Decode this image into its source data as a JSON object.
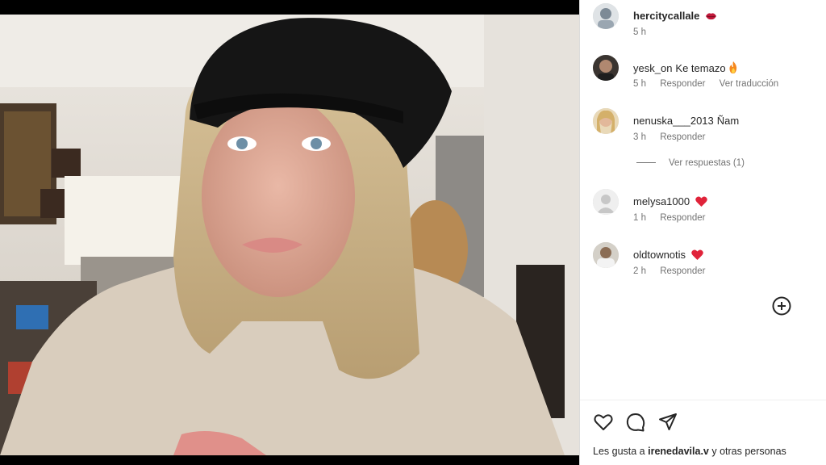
{
  "post": {
    "photo_alt": "selfie photo"
  },
  "comments": [
    {
      "user": "hercitycallale",
      "text": "",
      "emoji": "lips",
      "time": "5 h",
      "reply_label": "",
      "translate_label": ""
    },
    {
      "user": "yesk_on",
      "text": "Ke temazo",
      "emoji": "fire",
      "time": "5 h",
      "reply_label": "Responder",
      "translate_label": "Ver traducción"
    },
    {
      "user": "nenuska___2013",
      "text": "Ñam",
      "emoji": "",
      "time": "3 h",
      "reply_label": "Responder",
      "translate_label": ""
    },
    {
      "user": "melysa1000",
      "text": "",
      "emoji": "heart",
      "time": "1 h",
      "reply_label": "Responder",
      "translate_label": ""
    },
    {
      "user": "oldtownotis",
      "text": "",
      "emoji": "heart",
      "time": "2 h",
      "reply_label": "Responder",
      "translate_label": ""
    }
  ],
  "replies_toggle": "Ver respuestas (1)",
  "icons": {
    "add": "add-circle-icon",
    "like": "heart-outline-icon",
    "comment": "comment-bubble-icon",
    "share": "paper-plane-icon"
  },
  "likes": {
    "prefix": "Les gusta a",
    "user": "irenedavila.v",
    "suffix": "y otras personas"
  },
  "colors": {
    "text": "#262626",
    "muted": "#737373",
    "heart": "#ed4956"
  }
}
